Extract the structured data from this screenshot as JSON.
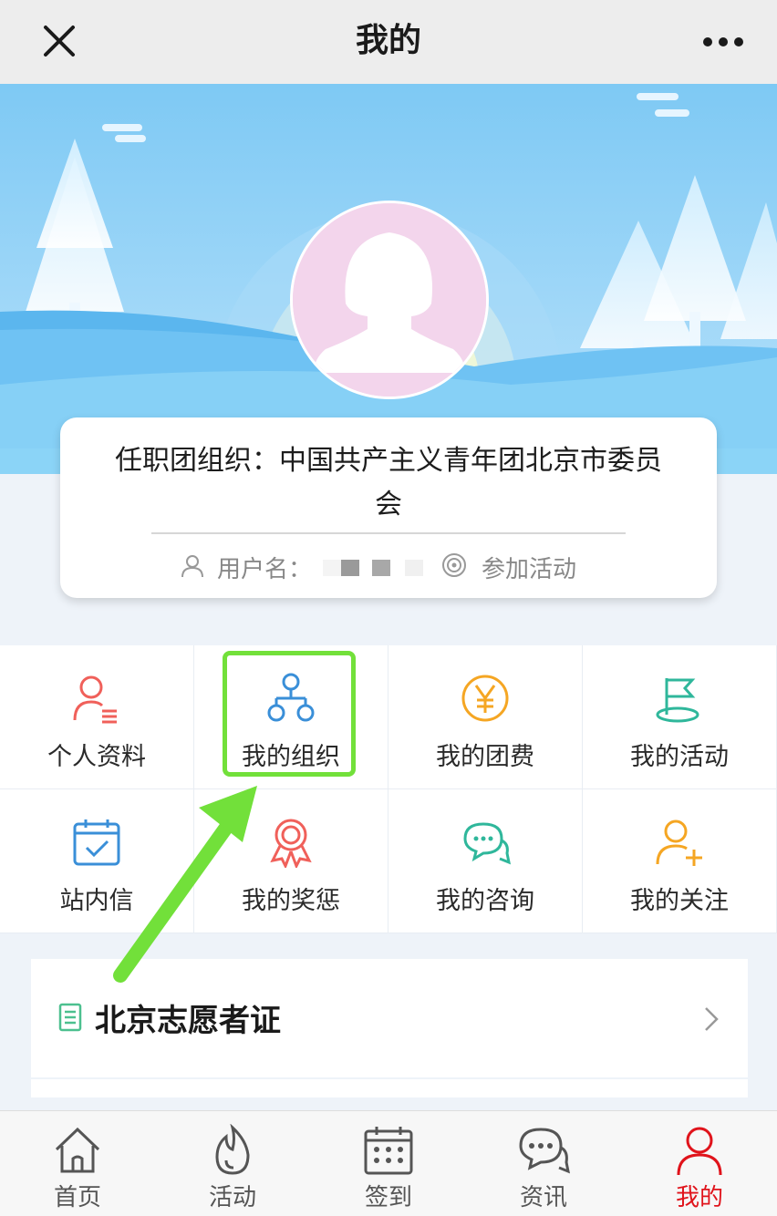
{
  "header": {
    "title": "我的",
    "close_icon": "close-icon",
    "more_icon": "more-icon"
  },
  "profile": {
    "org_text": "任职团组织：中国共产主义青年团北京市委员会",
    "username_label": "用户名：",
    "activity_label": "参加活动"
  },
  "grid": [
    {
      "label": "个人资料",
      "icon": "profile-icon",
      "color": "#f0605a"
    },
    {
      "label": "我的组织",
      "icon": "organization-icon",
      "color": "#3a8fd8"
    },
    {
      "label": "我的团费",
      "icon": "yuan-icon",
      "color": "#f5a623"
    },
    {
      "label": "我的活动",
      "icon": "flag-icon",
      "color": "#2fb79b"
    },
    {
      "label": "站内信",
      "icon": "calendar-mail-icon",
      "color": "#3a8fd8"
    },
    {
      "label": "我的奖惩",
      "icon": "medal-icon",
      "color": "#f0605a"
    },
    {
      "label": "我的咨询",
      "icon": "chat-icon",
      "color": "#2fb79b"
    },
    {
      "label": "我的关注",
      "icon": "add-user-icon",
      "color": "#f5a623"
    }
  ],
  "volunteer": {
    "label": "北京志愿者证"
  },
  "tabs": [
    {
      "label": "首页",
      "icon": "home-icon"
    },
    {
      "label": "活动",
      "icon": "flame-icon"
    },
    {
      "label": "签到",
      "icon": "calendar-icon"
    },
    {
      "label": "资讯",
      "icon": "chat-icon"
    },
    {
      "label": "我的",
      "icon": "user-icon",
      "active": true
    }
  ],
  "colors": {
    "accent_red": "#e0131b",
    "highlight_green": "#72e03a",
    "sky": "#8fcff5"
  }
}
